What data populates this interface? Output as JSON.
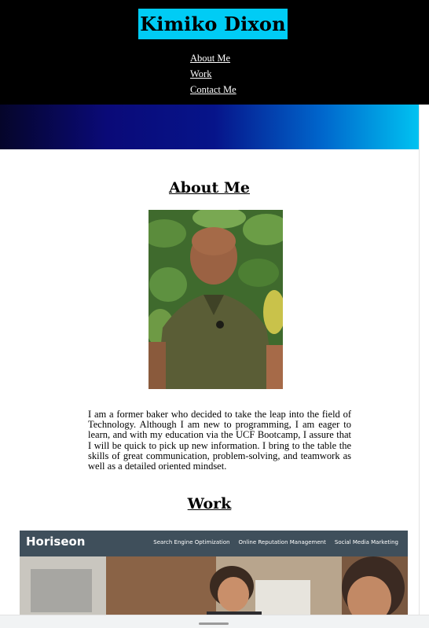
{
  "header": {
    "title": "Kimiko Dixon",
    "nav": [
      "About Me",
      "Work",
      "Contact Me"
    ]
  },
  "about": {
    "heading": "About Me",
    "photo_description": "portrait",
    "bio": "I am a former baker who decided to take the leap into the field of Technology. Although I am new to programming, I am eager to learn, and with my education via the UCF Bootcamp, I assure that I will be quick to pick up new information. I bring to the table the skills of great communication, problem-solving, and teamwork as well as a detailed oriented mindset."
  },
  "work": {
    "heading": "Work",
    "project": {
      "brand": "Horiseon",
      "links": [
        "Search Engine Optimization",
        "Online Reputation Management",
        "Social Media Marketing"
      ]
    }
  },
  "colors": {
    "accent": "#00ccf5",
    "header_bg": "#000000",
    "banner_start": "#05052a",
    "banner_end": "#00ccf5"
  }
}
